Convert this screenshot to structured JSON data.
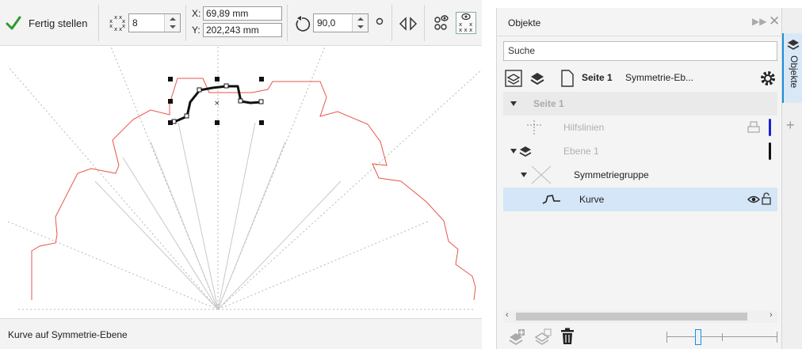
{
  "toolbar": {
    "done_label": "Fertig stellen",
    "count_value": "8",
    "x_label": "X:",
    "x_value": "69,89 mm",
    "y_label": "Y:",
    "y_value": "202,243 mm",
    "angle_value": "90,0"
  },
  "status_bar": {
    "text": "Kurve auf Symmetrie-Ebene"
  },
  "docker": {
    "title": "Objekte",
    "search_value": "Suche",
    "page_label": "Seite 1",
    "layer_label": "Symmetrie-Eb...",
    "tree": {
      "page": "Seite 1",
      "guides": "Hilfslinien",
      "layer": "Ebene 1",
      "group": "Symmetriegruppe",
      "curve": "Kurve"
    },
    "colors": {
      "guides_bar": "#1a22d6",
      "layer_bar": "#111111",
      "selection": "#d4e6f7"
    }
  },
  "side_tab": {
    "label": "Objekte"
  },
  "colors": {
    "accent_check": "#2e9a2e",
    "curve_red": "#e8554a",
    "tab_accent": "#1c8fd6"
  }
}
